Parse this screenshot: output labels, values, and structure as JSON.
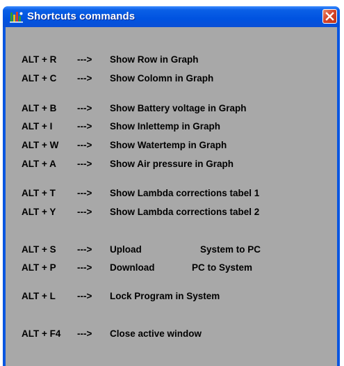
{
  "window": {
    "title": "Shortcuts commands"
  },
  "shortcuts": [
    {
      "key": "ALT + R",
      "arrow": "--->",
      "desc": "Show Row in Graph",
      "extra": ""
    },
    {
      "key": "ALT + C",
      "arrow": "--->",
      "desc": "Show Colomn in Graph",
      "extra": ""
    },
    {
      "key": "ALT + B",
      "arrow": "--->",
      "desc": "Show Battery voltage in Graph",
      "extra": ""
    },
    {
      "key": "ALT + I",
      "arrow": "--->",
      "desc": "Show Inlettemp in Graph",
      "extra": ""
    },
    {
      "key": "ALT + W",
      "arrow": "--->",
      "desc": "Show Watertemp in Graph",
      "extra": ""
    },
    {
      "key": "ALT + A",
      "arrow": "--->",
      "desc": "Show Air pressure in Graph",
      "extra": ""
    },
    {
      "key": "ALT + T",
      "arrow": "--->",
      "desc": "Show Lambda corrections tabel 1",
      "extra": ""
    },
    {
      "key": "ALT + Y",
      "arrow": "--->",
      "desc": "Show Lambda corrections tabel 2",
      "extra": ""
    },
    {
      "key": "ALT + S",
      "arrow": "--->",
      "desc": "Upload",
      "extra": "System to PC"
    },
    {
      "key": "ALT + P",
      "arrow": "--->",
      "desc": "Download",
      "extra": "PC to System"
    },
    {
      "key": "ALT + L",
      "arrow": "--->",
      "desc": "Lock Program in System",
      "extra": ""
    },
    {
      "key": "ALT + F4",
      "arrow": "--->",
      "desc": "Close active window",
      "extra": ""
    }
  ],
  "icons": {
    "app": "app-icon",
    "close": "close-icon"
  },
  "colors": {
    "titlebar": "#0053e0",
    "client_bg": "#a8a8a8",
    "close_button": "#d5462b"
  }
}
